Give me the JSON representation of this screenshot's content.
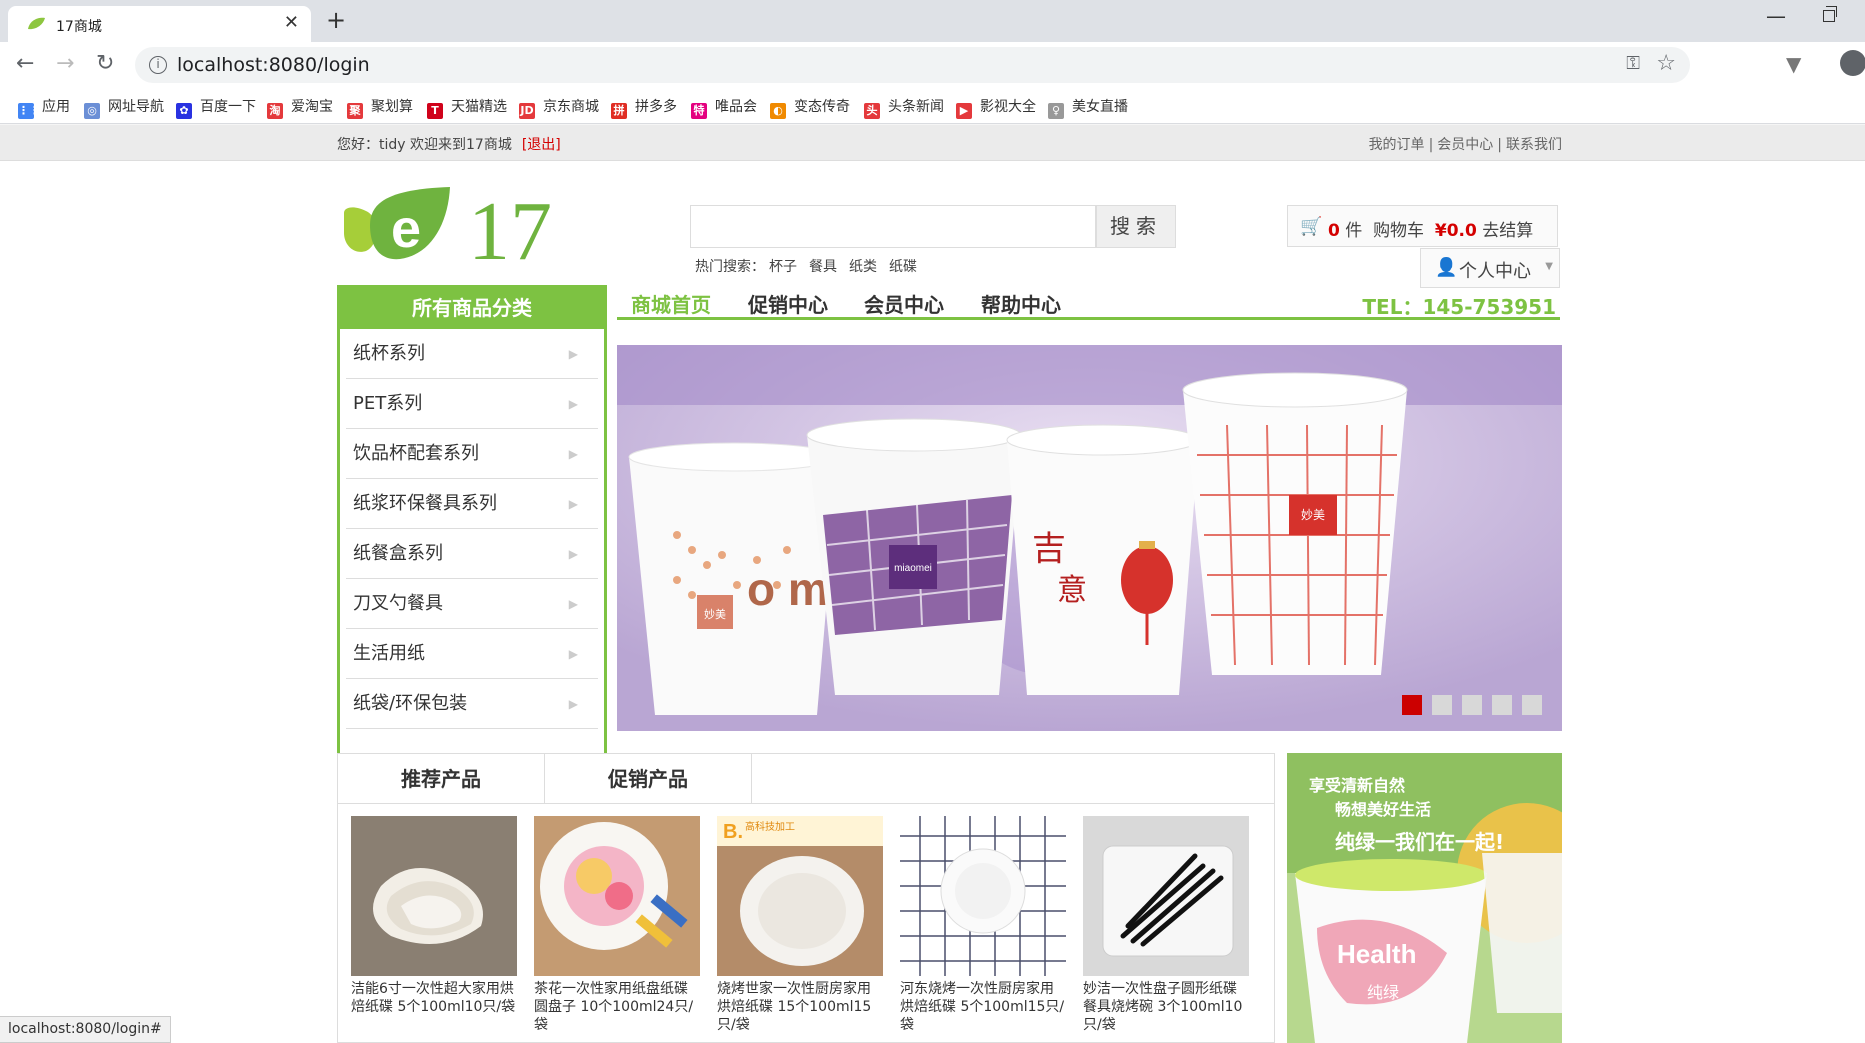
{
  "browser": {
    "tab_title": "17商城",
    "url": "localhost:8080/login",
    "status_url": "localhost:8080/login#",
    "bookmarks": [
      {
        "label": "应用",
        "icon": "apps-icon",
        "color": "#4285f4"
      },
      {
        "label": "网址导航",
        "icon": "globe-icon",
        "color": "#6b8fd6"
      },
      {
        "label": "百度一下",
        "icon": "baidu-icon",
        "color": "#2932e1"
      },
      {
        "label": "爱淘宝",
        "icon": "aitaobao-icon",
        "color": "#e4393c"
      },
      {
        "label": "聚划算",
        "icon": "juhuasuan-icon",
        "color": "#e4393c"
      },
      {
        "label": "天猫精选",
        "icon": "tmall-icon",
        "color": "#d0021b"
      },
      {
        "label": "京东商城",
        "icon": "jd-icon",
        "color": "#e4393c"
      },
      {
        "label": "拼多多",
        "icon": "pinduoduo-icon",
        "color": "#e02e24"
      },
      {
        "label": "唯品会",
        "icon": "vip-icon",
        "color": "#e4007f"
      },
      {
        "label": "变态传奇",
        "icon": "game-icon",
        "color": "#f08a00"
      },
      {
        "label": "头条新闻",
        "icon": "toutiao-icon",
        "color": "#e4393c"
      },
      {
        "label": "影视大全",
        "icon": "video-icon",
        "color": "#e4393c"
      },
      {
        "label": "美女直播",
        "icon": "live-icon",
        "color": "#999999"
      }
    ]
  },
  "site": {
    "welcome": "您好：tidy 欢迎来到17商城",
    "logout": "[退出]",
    "top_links": [
      "我的订单",
      "会员中心",
      "联系我们"
    ],
    "logo_text": "17",
    "logo_letter": "e",
    "search_button": "搜索",
    "hot_label": "热门搜索：",
    "hot_terms": [
      "杯子",
      "餐具",
      "纸类",
      "纸碟"
    ],
    "cart": {
      "count": "0",
      "count_unit": "件",
      "label": "购物车",
      "amount": "¥0.0",
      "checkout": "去结算"
    },
    "user_center": "个人中心",
    "category_title": "所有商品分类",
    "categories": [
      "纸杯系列",
      "PET系列",
      "饮品杯配套系列",
      "纸浆环保餐具系列",
      "纸餐盒系列",
      "刀叉勺餐具",
      "生活用纸",
      "纸袋/环保包装"
    ],
    "nav": [
      "商城首页",
      "促销中心",
      "会员中心",
      "帮助中心"
    ],
    "tel": "TEL：145-753951",
    "banner_dots": 5,
    "product_tabs": [
      "推荐产品",
      "促销产品"
    ],
    "products": [
      {
        "name": "洁能6寸一次性超大家用烘焙纸碟 5个100ml10只/袋"
      },
      {
        "name": "茶花一次性家用纸盘纸碟圆盘子 10个100ml24只/袋"
      },
      {
        "name": "烧烤世家一次性厨房家用烘焙纸碟 15个100ml15只/袋"
      },
      {
        "name": "河东烧烤一次性厨房家用烘焙纸碟 5个100ml15只/袋"
      },
      {
        "name": "妙洁一次性盘子圆形纸碟餐具烧烤碗 3个100ml10只/袋"
      }
    ],
    "banner_texts": {
      "brand": "miaomei",
      "brand_cn": "妙美"
    },
    "side_banner": {
      "line1": "享受清新自然",
      "line2": "畅想美好生活",
      "line3": "纯绿一我们在一起!",
      "cup": "Health",
      "cup_cn": "纯绿"
    },
    "product3_badge": "高科技加工",
    "accent": "#7dc242",
    "price_red": "#d40000"
  }
}
